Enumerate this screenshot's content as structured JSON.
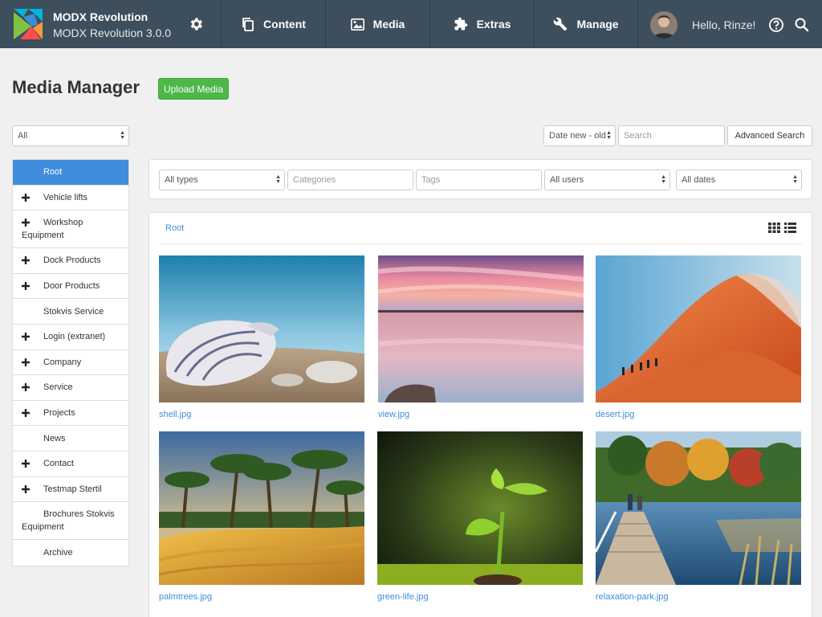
{
  "app": {
    "name": "MODX Revolution",
    "version": "MODX Revolution 3.0.0"
  },
  "nav": {
    "content": "Content",
    "media": "Media",
    "extras": "Extras",
    "manage": "Manage"
  },
  "user": {
    "greeting": "Hello, Rinze!"
  },
  "page": {
    "title": "Media Manager",
    "upload_label": "Upload Media"
  },
  "source_select": "All",
  "sort_select": "Date new - old",
  "search": {
    "placeholder": "Search",
    "advanced_label": "Advanced Search"
  },
  "filters": {
    "types": "All types",
    "categories_placeholder": "Categories",
    "tags_placeholder": "Tags",
    "users": "All users",
    "dates": "All dates"
  },
  "tree": [
    {
      "label": "Root",
      "expandable": false,
      "active": true
    },
    {
      "label": "Vehicle lifts",
      "expandable": true
    },
    {
      "label": "Workshop Equipment",
      "expandable": true
    },
    {
      "label": "Dock Products",
      "expandable": true
    },
    {
      "label": "Door Products",
      "expandable": true
    },
    {
      "label": "Stokvis Service",
      "expandable": false
    },
    {
      "label": "Login (extranet)",
      "expandable": true
    },
    {
      "label": "Company",
      "expandable": true
    },
    {
      "label": "Service",
      "expandable": true
    },
    {
      "label": "Projects",
      "expandable": true
    },
    {
      "label": "News",
      "expandable": false
    },
    {
      "label": "Contact",
      "expandable": true
    },
    {
      "label": "Testmap Stertil",
      "expandable": true
    },
    {
      "label": "Brochures Stokvis Equipment",
      "expandable": false
    },
    {
      "label": "Archive",
      "expandable": false
    }
  ],
  "breadcrumb": "Root",
  "media": [
    {
      "filename": "shell.jpg"
    },
    {
      "filename": "view.jpg"
    },
    {
      "filename": "desert.jpg"
    },
    {
      "filename": "palmtrees.jpg"
    },
    {
      "filename": "green-life.jpg"
    },
    {
      "filename": "relaxation-park.jpg"
    }
  ],
  "colors": {
    "topbar": "#3d4e5c",
    "accent": "#3f8ddc",
    "upload": "#4cb848"
  }
}
